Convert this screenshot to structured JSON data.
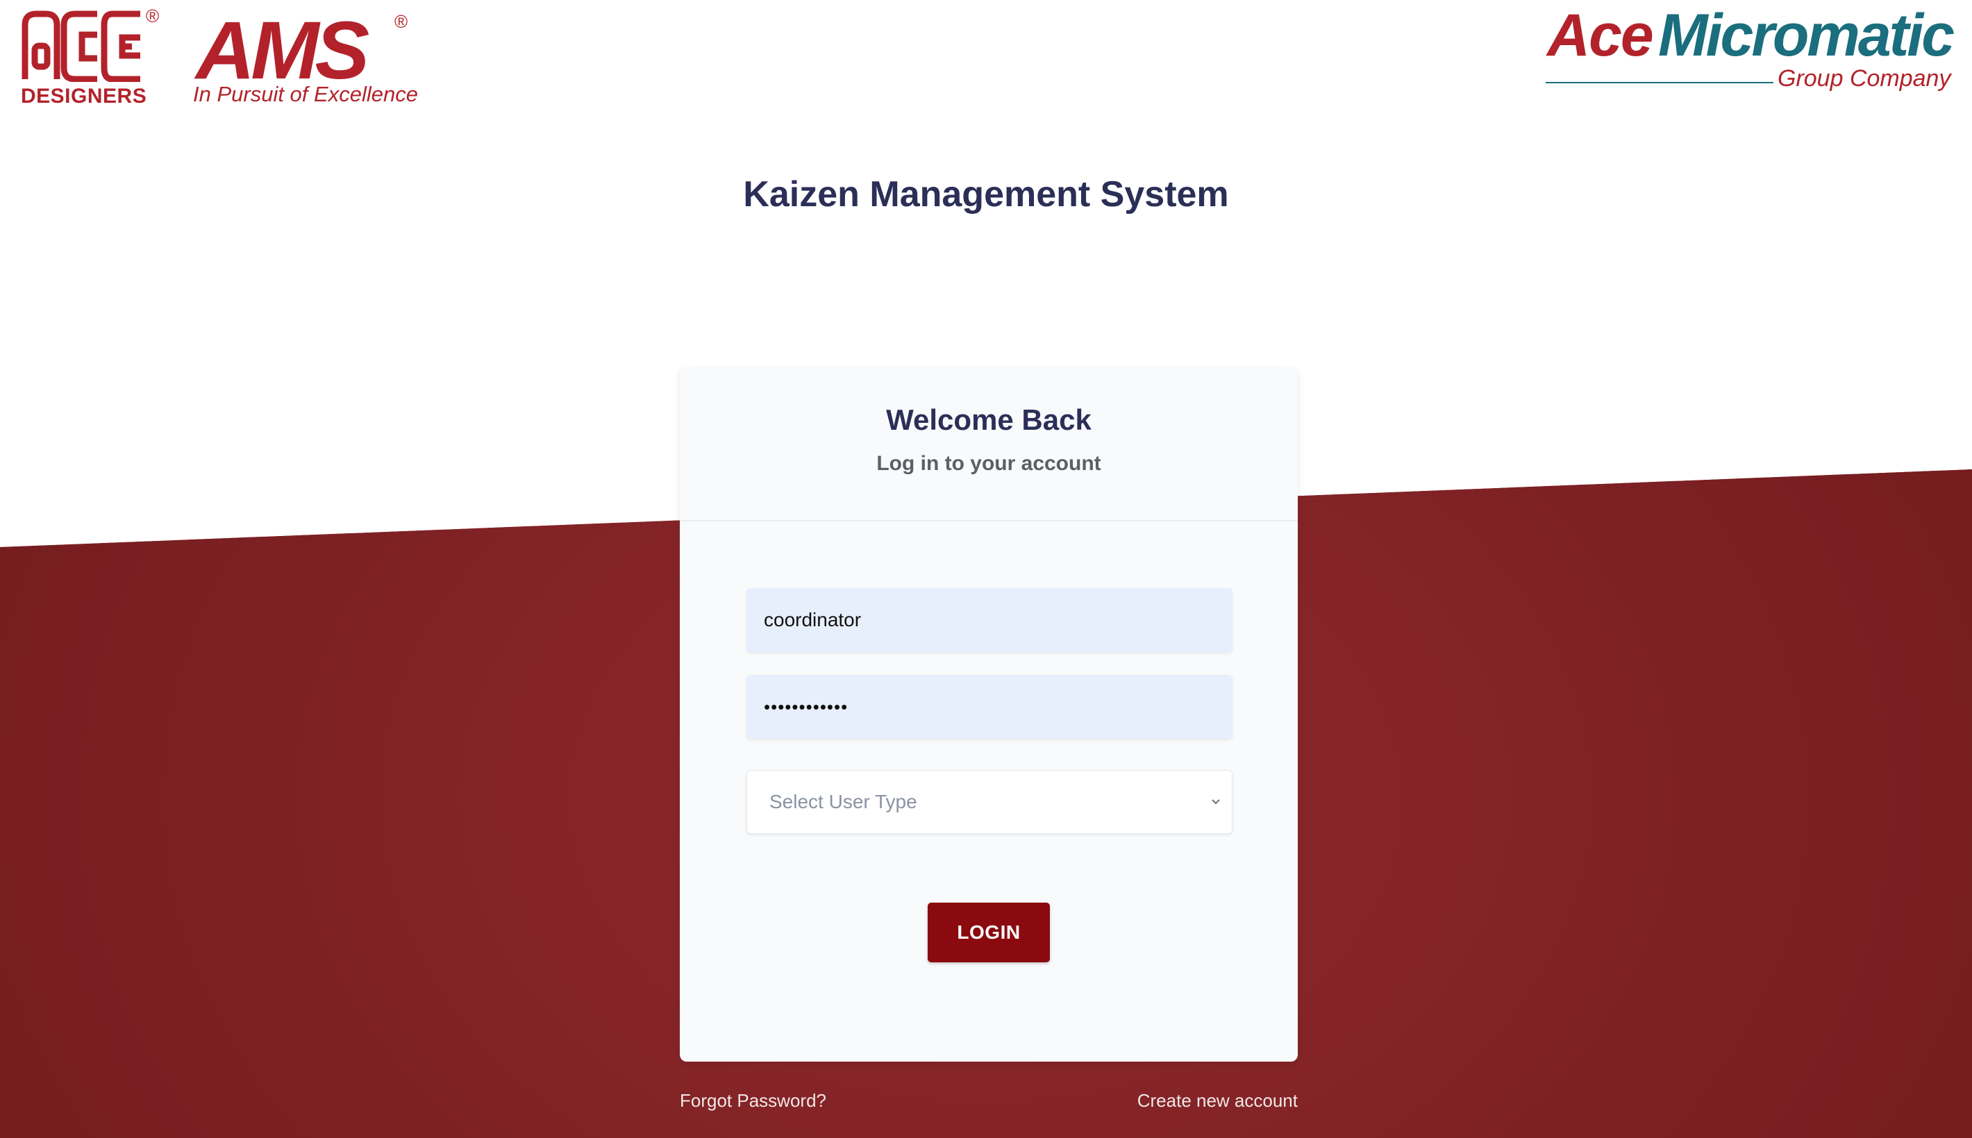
{
  "logos": {
    "ace_designers": {
      "label": "DESIGNERS",
      "registered": "®",
      "mark_text": "ACE"
    },
    "ams": {
      "name": "AMS",
      "registered": "®",
      "tagline": "In Pursuit of Excellence"
    },
    "ace_micromatic": {
      "ace": "Ace",
      "micromatic": "Micromatic",
      "group": "Group Company"
    }
  },
  "app_title": "Kaizen Management System",
  "card": {
    "welcome": "Welcome Back",
    "subtitle": "Log in to your account"
  },
  "form": {
    "username_value": "coordinator",
    "password_value": "••••••••••••",
    "user_type_placeholder": "Select User Type",
    "login_label": "LOGIN"
  },
  "links": {
    "forgot_password": "Forgot Password?",
    "create_account": "Create new account"
  },
  "colors": {
    "brand_red": "#b3222a",
    "brand_teal": "#1a6e7d",
    "title_navy": "#2b2f57",
    "button_red": "#8b0a0f",
    "background_red": "#842427",
    "input_blue": "#e8effc"
  },
  "icons": {
    "select_arrow": "chevron-down-icon"
  }
}
